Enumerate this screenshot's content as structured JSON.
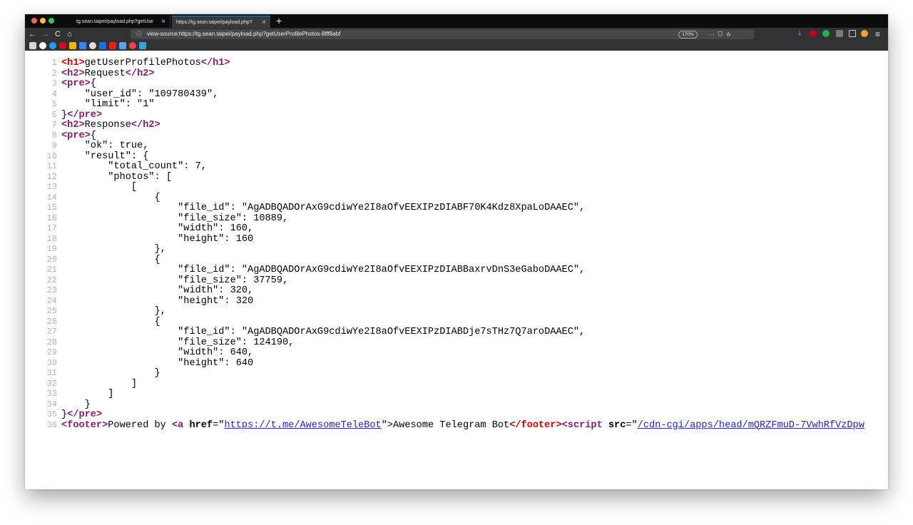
{
  "browser": {
    "tabs": [
      {
        "label": "tg.sean.taipei/payload.php?getUse"
      },
      {
        "label": "https://tg.sean.taipei/payload.php?"
      }
    ],
    "new_tab": "+",
    "tab_close": "×",
    "url": "view-source:https://tg.sean.taipei/payload.php?getUserProfilePhotos-8fff8abf",
    "zoom": "170%",
    "url_actions": "··· ⛉ ☆",
    "nav": {
      "back": "←",
      "forward": "→",
      "reload": "C",
      "home": "⌂",
      "info": "ⓘ",
      "menu": "≡"
    }
  },
  "source": {
    "lines": [
      {
        "n": "1",
        "h1o": "<h1>",
        "text": "getUserProfilePhotos",
        "h1c": "</h1>"
      },
      {
        "n": "2",
        "o": "<h2>",
        "text": "Request",
        "c": "</h2>"
      },
      {
        "n": "3",
        "o": "<pre>",
        "text": "{"
      },
      {
        "n": "4",
        "text": "    \"user_id\": \"109780439\","
      },
      {
        "n": "5",
        "text": "    \"limit\": \"1\""
      },
      {
        "n": "6",
        "pre": "}",
        "c": "</pre>"
      },
      {
        "n": "7",
        "o": "<h2>",
        "text": "Response",
        "c": "</h2>"
      },
      {
        "n": "8",
        "o": "<pre>",
        "text": "{"
      },
      {
        "n": "9",
        "text": "    \"ok\": true,"
      },
      {
        "n": "10",
        "text": "    \"result\": {"
      },
      {
        "n": "11",
        "text": "        \"total_count\": 7,"
      },
      {
        "n": "12",
        "text": "        \"photos\": ["
      },
      {
        "n": "13",
        "text": "            ["
      },
      {
        "n": "14",
        "text": "                {"
      },
      {
        "n": "15",
        "text": "                    \"file_id\": \"AgADBQADOrAxG9cdiwYe2I8aOfvEEXIPzDIABF70K4Kdz8XpaLoDAAEC\","
      },
      {
        "n": "16",
        "text": "                    \"file_size\": 10889,"
      },
      {
        "n": "17",
        "text": "                    \"width\": 160,"
      },
      {
        "n": "18",
        "text": "                    \"height\": 160"
      },
      {
        "n": "19",
        "text": "                },"
      },
      {
        "n": "20",
        "text": "                {"
      },
      {
        "n": "21",
        "text": "                    \"file_id\": \"AgADBQADOrAxG9cdiwYe2I8aOfvEEXIPzDIABBaxrvDnS3eGaboDAAEC\","
      },
      {
        "n": "22",
        "text": "                    \"file_size\": 37759,"
      },
      {
        "n": "23",
        "text": "                    \"width\": 320,"
      },
      {
        "n": "24",
        "text": "                    \"height\": 320"
      },
      {
        "n": "25",
        "text": "                },"
      },
      {
        "n": "26",
        "text": "                {"
      },
      {
        "n": "27",
        "text": "                    \"file_id\": \"AgADBQADOrAxG9cdiwYe2I8aOfvEEXIPzDIABDje7sTHz7Q7aroDAAEC\","
      },
      {
        "n": "28",
        "text": "                    \"file_size\": 124190,"
      },
      {
        "n": "29",
        "text": "                    \"width\": 640,"
      },
      {
        "n": "30",
        "text": "                    \"height\": 640"
      },
      {
        "n": "31",
        "text": "                }"
      },
      {
        "n": "32",
        "text": "            ]"
      },
      {
        "n": "33",
        "text": "        ]"
      },
      {
        "n": "34",
        "text": "    }"
      },
      {
        "n": "35",
        "pre": "}",
        "c": "</pre>"
      }
    ],
    "footer_line": {
      "n": "36",
      "footer_open": "<footer>",
      "powered": "Powered by ",
      "a_open": "<a ",
      "href_attr": "href",
      "eq_quote": "=\"",
      "href_value": "https://t.me/AwesomeTeleBot",
      "close_quote": "\">",
      "link_text": "Awesome Telegram Bot",
      "footer_close": "</footer>",
      "script_open": "<script ",
      "src_attr": "src",
      "src_value": "/cdn-cgi/apps/head/mQRZFmuD-7VwhRfVzDpw"
    }
  }
}
